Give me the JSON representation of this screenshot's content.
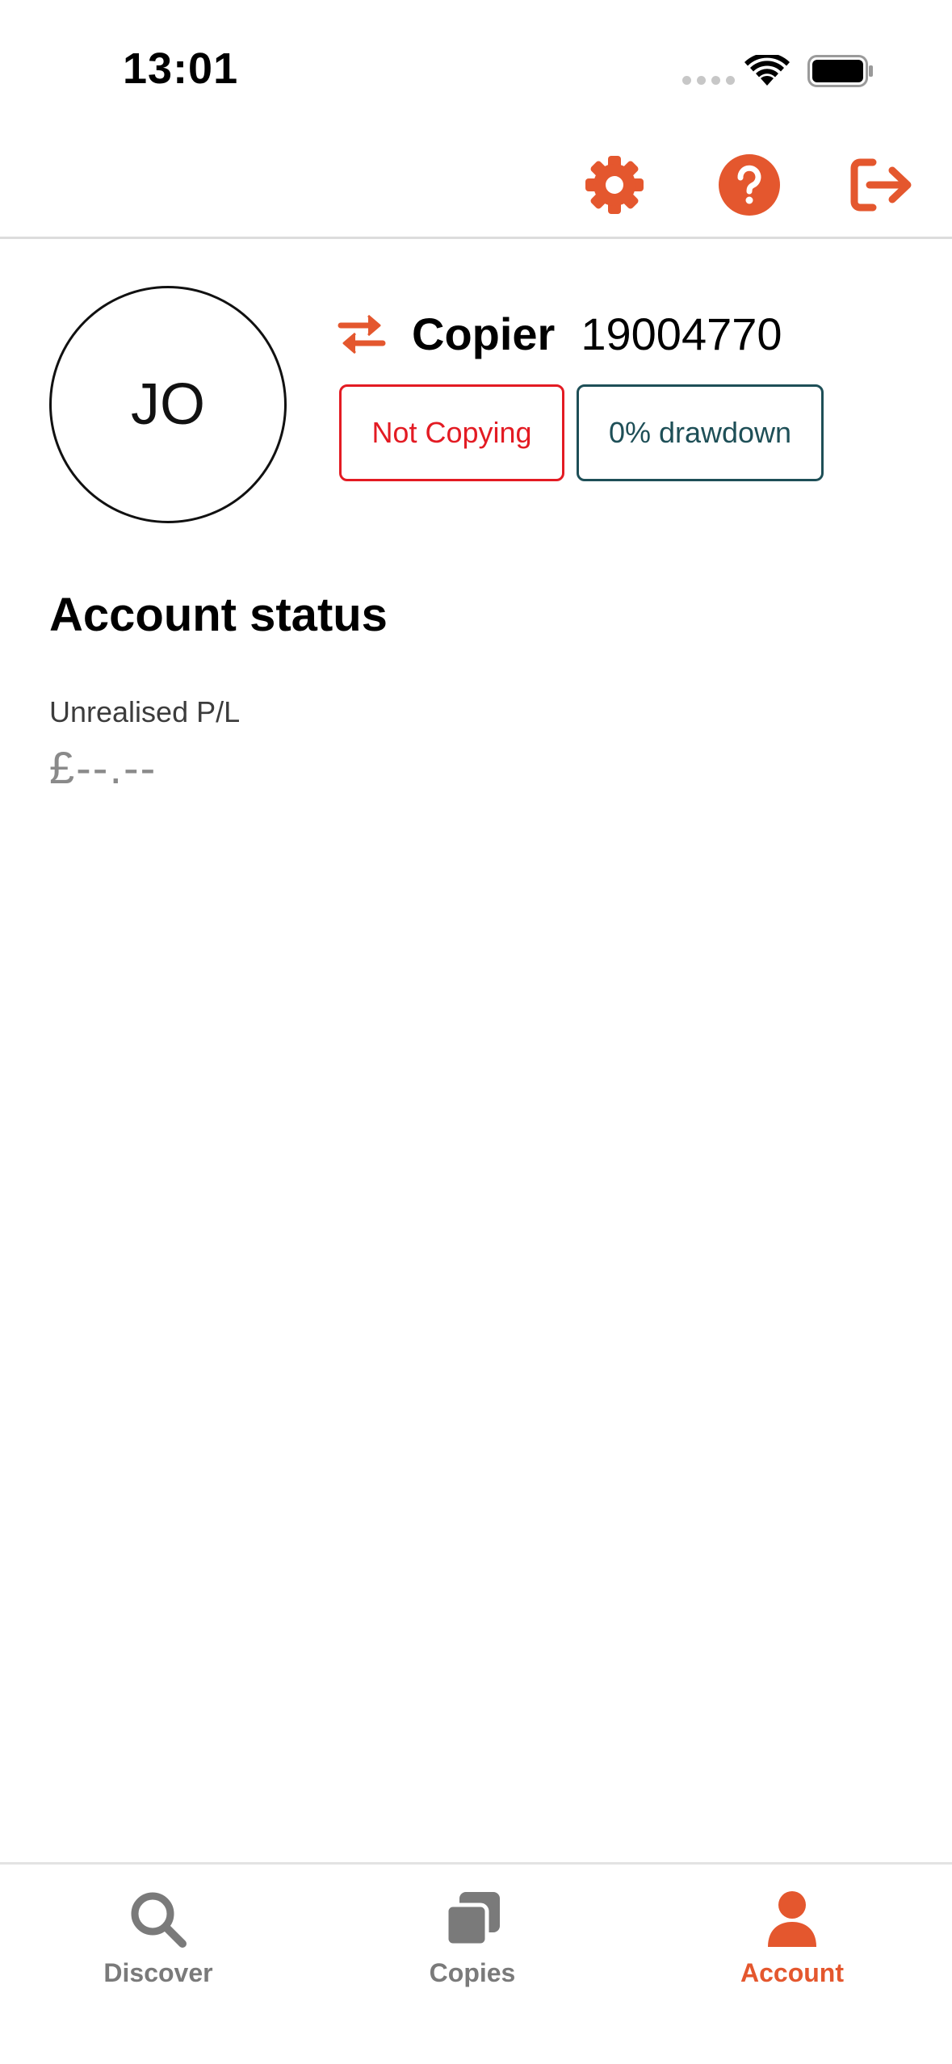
{
  "status_bar": {
    "time": "13:01"
  },
  "toolbar": {
    "icons": [
      "gear-icon",
      "help-icon",
      "logout-icon"
    ]
  },
  "profile": {
    "initials": "JO",
    "role_label": "Copier",
    "account_number": "19004770",
    "badges": {
      "copy_status": "Not Copying",
      "drawdown": "0% drawdown"
    }
  },
  "account_status": {
    "title": "Account status",
    "unrealised_label": "Unrealised P/L",
    "unrealised_value": "£--.--"
  },
  "tabs": [
    {
      "label": "Discover",
      "icon": "search-icon"
    },
    {
      "label": "Copies",
      "icon": "copies-icon"
    },
    {
      "label": "Account",
      "icon": "person-icon",
      "active": true
    }
  ],
  "colors": {
    "accent": "#e4572e",
    "not_copying": "#e31b23",
    "drawdown": "#1e4f57",
    "inactive_tab": "#7a7a7a"
  }
}
